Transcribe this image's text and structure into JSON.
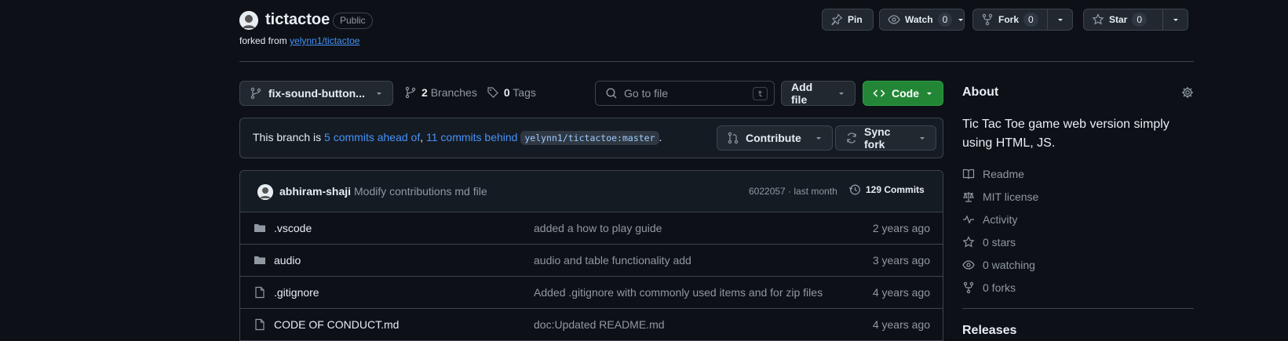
{
  "repo": {
    "name": "tictactoe",
    "visibility": "Public",
    "forked_prefix": "forked from",
    "forked_from": "yelynn1/tictactoe"
  },
  "header_actions": {
    "pin_label": "Pin",
    "watch_label": "Watch",
    "watch_count": "0",
    "fork_label": "Fork",
    "fork_count": "0",
    "star_label": "Star",
    "star_count": "0"
  },
  "toolbar": {
    "branch_name": "fix-sound-button...",
    "branches_count": "2",
    "branches_label": "Branches",
    "tags_count": "0",
    "tags_label": "Tags",
    "search_placeholder": "Go to file",
    "search_shortcut": "t",
    "add_file_label": "Add file",
    "code_label": "Code"
  },
  "branch_status": {
    "prefix": "This branch is",
    "ahead": "5 commits ahead of",
    "comma": ",",
    "behind": "11 commits behind",
    "upstream": "yelynn1/tictactoe:master",
    "suffix": ".",
    "contribute_label": "Contribute",
    "sync_label": "Sync fork"
  },
  "latest_commit": {
    "author": "abhiram-shaji",
    "message": "Modify contributions md file",
    "hash_and_time": "6022057 · last month",
    "commits_label": "129 Commits"
  },
  "files": [
    {
      "type": "folder",
      "name": ".vscode",
      "commit": "added a how to play guide",
      "date": "2 years ago"
    },
    {
      "type": "folder",
      "name": "audio",
      "commit": "audio and table functionality add",
      "date": "3 years ago"
    },
    {
      "type": "file",
      "name": ".gitignore",
      "commit": "Added .gitignore with commonly used items and for zip files",
      "date": "4 years ago"
    },
    {
      "type": "file",
      "name": "CODE OF CONDUCT.md",
      "commit": "doc:Updated README.md",
      "date": "4 years ago"
    }
  ],
  "about": {
    "title": "About",
    "description": "Tic Tac Toe game web version simply using HTML, JS.",
    "items": [
      {
        "icon": "book-icon",
        "label": "Readme"
      },
      {
        "icon": "law-icon",
        "label": "MIT license"
      },
      {
        "icon": "pulse-icon",
        "label": "Activity"
      },
      {
        "icon": "star-icon",
        "label": "0 stars"
      },
      {
        "icon": "eye-icon",
        "label": "0 watching"
      },
      {
        "icon": "fork-icon",
        "label": "0 forks"
      }
    ],
    "releases_title": "Releases"
  },
  "colors": {
    "background": "#0d1117",
    "accent_link": "#4493f8",
    "code_button": "#238636",
    "border": "#3d444d"
  }
}
